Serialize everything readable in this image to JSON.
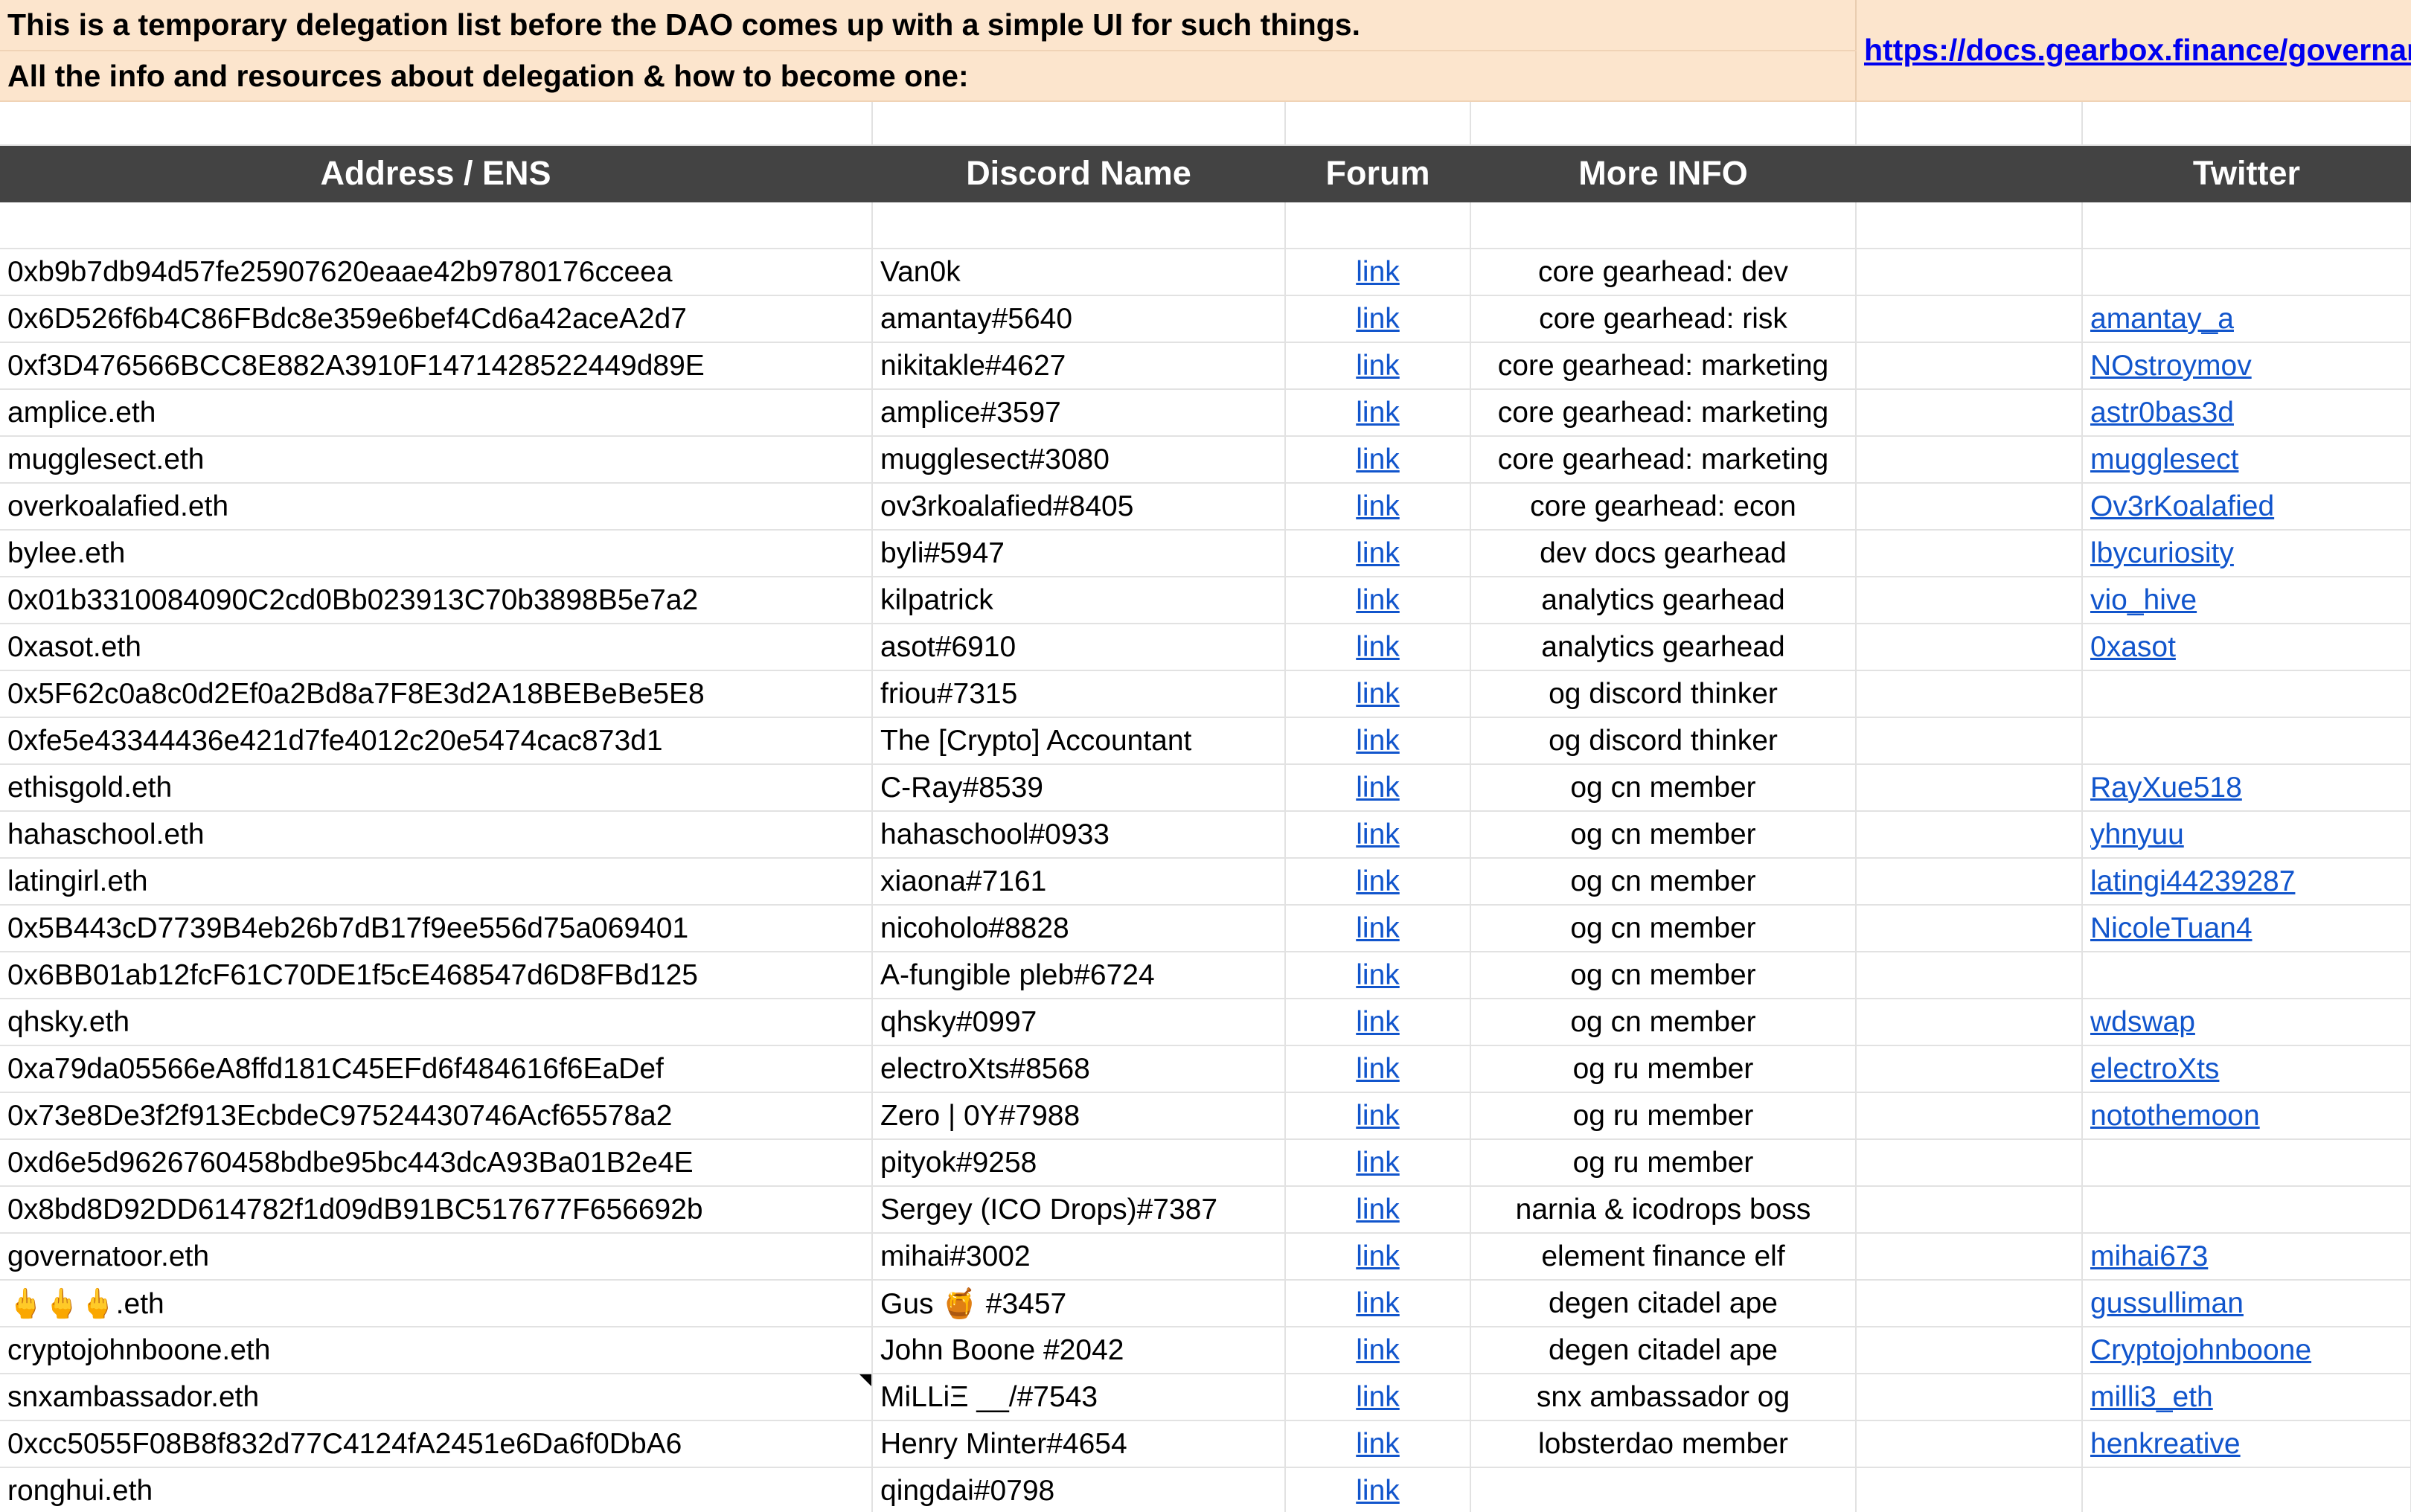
{
  "banner": {
    "line1": "This is a temporary delegation list before the DAO comes up with a simple UI for such things.",
    "line2": "All the info and resources about delegation & how to become one:",
    "docs_link": "https://docs.gearbox.finance/governance/community-delegates"
  },
  "columns": {
    "address": "Address / ENS",
    "discord": "Discord Name",
    "forum": "Forum",
    "more_info": "More INFO",
    "extra": "",
    "twitter": "Twitter"
  },
  "rows": [
    {
      "address": "0xb9b7db94d57fe25907620eaae42b9780176cceea",
      "discord": "Van0k",
      "forum": "link",
      "info": "core gearhead: dev",
      "twitter": ""
    },
    {
      "address": "0x6D526f6b4C86FBdc8e359e6bef4Cd6a42aceA2d7",
      "discord": "amantay#5640",
      "forum": "link",
      "info": "core gearhead: risk",
      "twitter": "amantay_a"
    },
    {
      "address": "0xf3D476566BCC8E882A3910F1471428522449d89E",
      "discord": "nikitakle#4627",
      "forum": "link",
      "info": "core gearhead: marketing",
      "twitter": "NOstroymov"
    },
    {
      "address": "amplice.eth",
      "discord": "amplice#3597",
      "forum": "link",
      "info": "core gearhead: marketing",
      "twitter": "astr0bas3d"
    },
    {
      "address": "mugglesect.eth",
      "discord": "mugglesect#3080",
      "forum": "link",
      "info": "core gearhead: marketing",
      "twitter": "mugglesect"
    },
    {
      "address": "overkoalafied.eth",
      "discord": "ov3rkoalafied#8405",
      "forum": "link",
      "info": "core gearhead: econ",
      "twitter": "Ov3rKoalafied"
    },
    {
      "address": "bylee.eth",
      "discord": "byli#5947",
      "forum": "link",
      "info": "dev docs gearhead",
      "twitter": "lbycuriosity"
    },
    {
      "address": "0x01b3310084090C2cd0Bb023913C70b3898B5e7a2",
      "discord": "kilpatrick",
      "forum": "link",
      "info": "analytics gearhead",
      "twitter": "vio_hive"
    },
    {
      "address": "0xasot.eth",
      "discord": "asot#6910",
      "forum": "link",
      "info": "analytics gearhead",
      "twitter": "0xasot"
    },
    {
      "address": "0x5F62c0a8c0d2Ef0a2Bd8a7F8E3d2A18BEBeBe5E8",
      "discord": "friou#7315",
      "forum": "link",
      "info": "og discord thinker",
      "twitter": ""
    },
    {
      "address": "0xfe5e43344436e421d7fe4012c20e5474cac873d1",
      "discord": "The [Crypto] Accountant",
      "forum": "link",
      "info": "og discord thinker",
      "twitter": ""
    },
    {
      "address": "ethisgold.eth",
      "discord": "C-Ray#8539",
      "forum": "link",
      "info": "og cn member",
      "twitter": "RayXue518"
    },
    {
      "address": "hahaschool.eth",
      "discord": "hahaschool#0933",
      "forum": "link",
      "info": "og cn member",
      "twitter": "yhnyuu"
    },
    {
      "address": "latingirl.eth",
      "discord": "xiaona#7161",
      "forum": "link",
      "info": "og cn member",
      "twitter": "latingi44239287"
    },
    {
      "address": "0x5B443cD7739B4eb26b7dB17f9ee556d75a069401",
      "discord": "nicoholo#8828",
      "forum": "link",
      "info": "og cn member",
      "twitter": "NicoleTuan4"
    },
    {
      "address": "0x6BB01ab12fcF61C70DE1f5cE468547d6D8FBd125",
      "discord": "A-fungible pleb#6724",
      "forum": "link",
      "info": "og cn member",
      "twitter": ""
    },
    {
      "address": "qhsky.eth",
      "discord": "qhsky#0997",
      "forum": "link",
      "info": "og cn member",
      "twitter": "wdswap"
    },
    {
      "address": "0xa79da05566eA8ffd181C45EFd6f484616f6EaDef",
      "discord": "electroXts#8568",
      "forum": "link",
      "info": "og ru member",
      "twitter": "electroXts"
    },
    {
      "address": "0x73e8De3f2f913EcbdeC97524430746Acf65578a2",
      "discord": "Zero | 0Y#7988",
      "forum": "link",
      "info": "og ru member",
      "twitter": "notothemoon"
    },
    {
      "address": "0xd6e5d9626760458bdbe95bc443dcA93Ba01B2e4E",
      "discord": "pityok#9258",
      "forum": "link",
      "info": "og ru member",
      "twitter": ""
    },
    {
      "address": "0x8bd8D92DD614782f1d09dB91BC517677F656692b",
      "discord": "Sergey (ICO Drops)#7387",
      "forum": "link",
      "info": "narnia & icodrops boss",
      "twitter": ""
    },
    {
      "address": "governatoor.eth",
      "discord": "mihai#3002",
      "forum": "link",
      "info": "element finance elf",
      "twitter": "mihai673"
    },
    {
      "address": "🖕🖕🖕.eth",
      "discord": "Gus 🍯 #3457",
      "forum": "link",
      "info": "degen citadel ape",
      "twitter": "gussulliman"
    },
    {
      "address": "cryptojohnboone.eth",
      "discord": "John Boone #2042",
      "forum": "link",
      "info": "degen citadel ape",
      "twitter": "Cryptojohnboone"
    },
    {
      "address": "snxambassador.eth",
      "discord": "MiLLiΞ __/#7543",
      "forum": "link",
      "info": "snx ambassador og",
      "twitter": "milli3_eth"
    },
    {
      "address": "0xcc5055F08B8f832d77C4124fA2451e6Da6f0DbA6",
      "discord": "Henry Minter#4654",
      "forum": "link",
      "info": "lobsterdao member",
      "twitter": "henkreative"
    },
    {
      "address": "ronghui.eth",
      "discord": "qingdai#0798",
      "forum": "link",
      "info": "",
      "twitter": ""
    }
  ],
  "colors": {
    "banner_bg": "#fce5cd",
    "header_bg": "#434343",
    "header_text": "#ffffff",
    "link": "#1155cc",
    "doc_link": "#0000ee",
    "gridline": "#e2e2e2"
  }
}
